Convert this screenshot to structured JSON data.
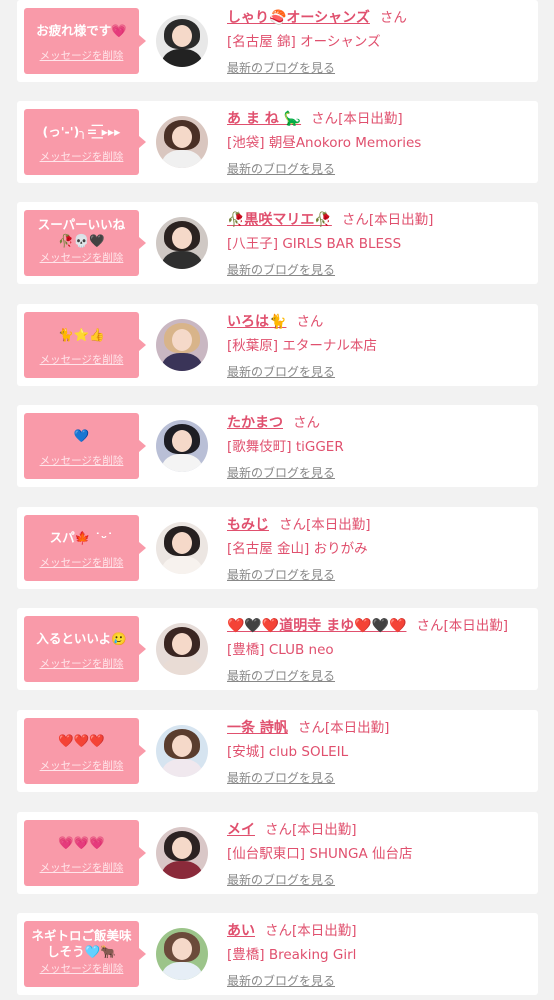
{
  "colors": {
    "page_bg": "#f2f2f2",
    "card_bg": "#ffffff",
    "bubble_pink": "#f99aa9",
    "accent_text": "#e0506e",
    "link_gray": "#888888"
  },
  "items": [
    {
      "message": "お疲れ様です💗",
      "delete_label": "メッセージを削除",
      "name": "しゃり🍣オーシャンズ",
      "honorific": "さん",
      "status": "",
      "shop": "[名古屋 錦] オーシャンズ",
      "blog_label": "最新のブログを見る",
      "avatar_hair": "#2a2a2a",
      "avatar_bg": "#e8e8e8",
      "avatar_body": "#222222"
    },
    {
      "message": "(っ'-')╮=͟͟͞͞ ▸▸▸",
      "delete_label": "メッセージを削除",
      "name": "あ ま ね 🦕",
      "honorific": "さん",
      "status": "[本日出勤]",
      "shop": "[池袋] 朝昼Anokoro Memories",
      "blog_label": "最新のブログを見る",
      "avatar_hair": "#4a3026",
      "avatar_bg": "#d9c6bf",
      "avatar_body": "#f0f0f0"
    },
    {
      "message": "スーパーいいね\n🥀💀🖤",
      "delete_label": "メッセージを削除",
      "name": "🥀黒咲マリエ🥀",
      "honorific": "さん",
      "status": "[本日出勤]",
      "shop": "[八王子] GIRLS BAR BLESS",
      "blog_label": "最新のブログを見る",
      "avatar_hair": "#2b2220",
      "avatar_bg": "#cfc8c4",
      "avatar_body": "#2f2f2f"
    },
    {
      "message": "🐈⭐👍",
      "delete_label": "メッセージを削除",
      "name": "いろは🐈",
      "honorific": "さん",
      "status": "",
      "shop": "[秋葉原] エターナル本店",
      "blog_label": "最新のブログを見る",
      "avatar_hair": "#d8b48a",
      "avatar_bg": "#c9b7c2",
      "avatar_body": "#3a3458"
    },
    {
      "message": "💙",
      "delete_label": "メッセージを削除",
      "name": "たかまつ",
      "honorific": "さん",
      "status": "",
      "shop": "[歌舞伎町] tiGGER",
      "blog_label": "最新のブログを見る",
      "avatar_hair": "#1e1e24",
      "avatar_bg": "#b9bfd6",
      "avatar_body": "#f4f4f4"
    },
    {
      "message": "スパ🍁 ˙ᵕ˙",
      "delete_label": "メッセージを削除",
      "name": "もみじ",
      "honorific": "さん",
      "status": "[本日出勤]",
      "shop": "[名古屋 金山] おりがみ",
      "blog_label": "最新のブログを見る",
      "avatar_hair": "#262020",
      "avatar_bg": "#ece6e2",
      "avatar_body": "#f7f2ee"
    },
    {
      "message": "入るといいよ🥲",
      "delete_label": "メッセージを削除",
      "name": "❤️🖤❤️道明寺 まゆ❤️🖤❤️",
      "honorific": "さん",
      "status": "[本日出勤]",
      "shop": "[豊橋] CLUB neo",
      "blog_label": "最新のブログを見る",
      "avatar_hair": "#3a2622",
      "avatar_bg": "#e6dcd8",
      "avatar_body": "#e9dcd5"
    },
    {
      "message": "❤️❤️❤️",
      "delete_label": "メッセージを削除",
      "name": "一条 詩帆",
      "honorific": "さん",
      "status": "[本日出勤]",
      "shop": "[安城] club SOLEIL",
      "blog_label": "最新のブログを見る",
      "avatar_hair": "#5a3d2e",
      "avatar_bg": "#d6e4f0",
      "avatar_body": "#f0e8ee"
    },
    {
      "message": "💗💗💗",
      "delete_label": "メッセージを削除",
      "name": "メイ",
      "honorific": "さん",
      "status": "[本日出勤]",
      "shop": "[仙台駅東口] SHUNGA 仙台店",
      "blog_label": "最新のブログを見る",
      "avatar_hair": "#2c2222",
      "avatar_bg": "#d9c7c7",
      "avatar_body": "#8a2a3a"
    },
    {
      "message": "ネギトロご飯美味\nしそう🩵🐂",
      "delete_label": "メッセージを削除",
      "name": "あい",
      "honorific": "さん",
      "status": "[本日出勤]",
      "shop": "[豊橋] Breaking Girl",
      "blog_label": "最新のブログを見る",
      "avatar_hair": "#6b4a3a",
      "avatar_bg": "#9cc48a",
      "avatar_body": "#e6eef6"
    }
  ]
}
